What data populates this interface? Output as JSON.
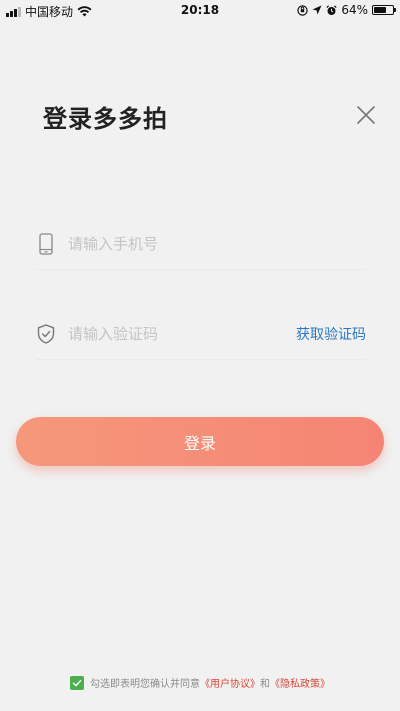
{
  "status_bar": {
    "carrier": "中国移动",
    "time": "20:18",
    "battery_percent_label": "64%",
    "battery_level": 0.64
  },
  "header": {
    "title": "登录多多拍",
    "close_icon": "close-icon"
  },
  "form": {
    "phone": {
      "icon": "phone-icon",
      "value": "",
      "placeholder": "请输入手机号"
    },
    "code": {
      "icon": "shield-check-icon",
      "value": "",
      "placeholder": "请输入验证码",
      "get_code_label": "获取验证码"
    }
  },
  "login_button": {
    "label": "登录"
  },
  "agreement": {
    "checked": true,
    "prefix": "勾选即表明您确认并同意",
    "user_agreement": "《用户协议》",
    "conjunction": "和",
    "privacy_policy": "《隐私政策》"
  },
  "colors": {
    "background": "#f1f1f1",
    "link_blue": "#2a78c2",
    "button_gradient_start": "#f5987a",
    "button_gradient_end": "#f58474",
    "agreement_link": "#d9463a",
    "checkbox_green": "#4cb04f"
  }
}
